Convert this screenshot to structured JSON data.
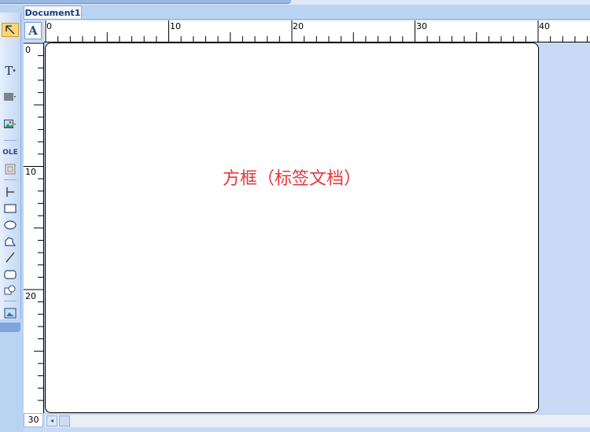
{
  "document_tab": {
    "title": "Document1"
  },
  "page": {
    "content_text": "方框（标签文档）"
  },
  "horizontal_ruler": {
    "labels": [
      "0",
      "10",
      "20",
      "30",
      "40"
    ]
  },
  "vertical_ruler": {
    "labels": [
      "0",
      "10",
      "20",
      "30"
    ]
  },
  "corner_button": {
    "glyph": "A"
  },
  "toolbar": {
    "tools": [
      {
        "name": "select-tool",
        "icon": "pointer-icon",
        "active": true
      },
      {
        "name": "text-tool",
        "icon": "text-icon",
        "glyph": "T"
      },
      {
        "name": "barcode-tool",
        "icon": "barcode-icon"
      },
      {
        "name": "image-tool",
        "icon": "picture-icon"
      },
      {
        "name": "ole-tool",
        "icon": "ole-icon",
        "glyph": "OLE"
      },
      {
        "name": "object-tool",
        "icon": "object-icon"
      },
      {
        "name": "line-tool",
        "icon": "vertical-line-icon"
      },
      {
        "name": "rectangle-tool",
        "icon": "rectangle-icon"
      },
      {
        "name": "ellipse-tool",
        "icon": "ellipse-icon"
      },
      {
        "name": "polygon-tool",
        "icon": "polygon-icon"
      },
      {
        "name": "diagonal-line-tool",
        "icon": "diagonal-line-icon"
      },
      {
        "name": "rounded-rect-tool",
        "icon": "rounded-rectangle-icon"
      },
      {
        "name": "shape-tool",
        "icon": "shape-icon"
      },
      {
        "name": "frame-tool",
        "icon": "frame-icon"
      }
    ]
  },
  "colors": {
    "accent": "#ffd67a",
    "text_red": "#e5383b",
    "chrome": "#b9d3f3"
  }
}
